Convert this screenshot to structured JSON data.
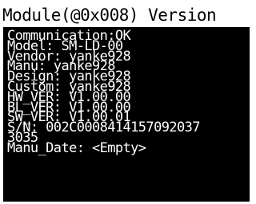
{
  "window": {
    "title": "Module(@0x008) Version"
  },
  "info": {
    "lines": [
      "Communication:OK",
      "Model: SM-LD-00",
      "Vendor: yanke928",
      "Manu: yanke928",
      "Design: yanke928",
      "Custom: yanke928",
      "HW_VER: V1.00.00",
      "BL_VER: V1.00.00",
      "SW_VER: V1.00.01",
      "S/N: 002C0008414157092037",
      "3035",
      "Manu_Date: <Empty>"
    ]
  },
  "colors": {
    "background": "#000000",
    "text": "#ffffff",
    "title_bg": "#ffffff",
    "title_text": "#000000"
  }
}
